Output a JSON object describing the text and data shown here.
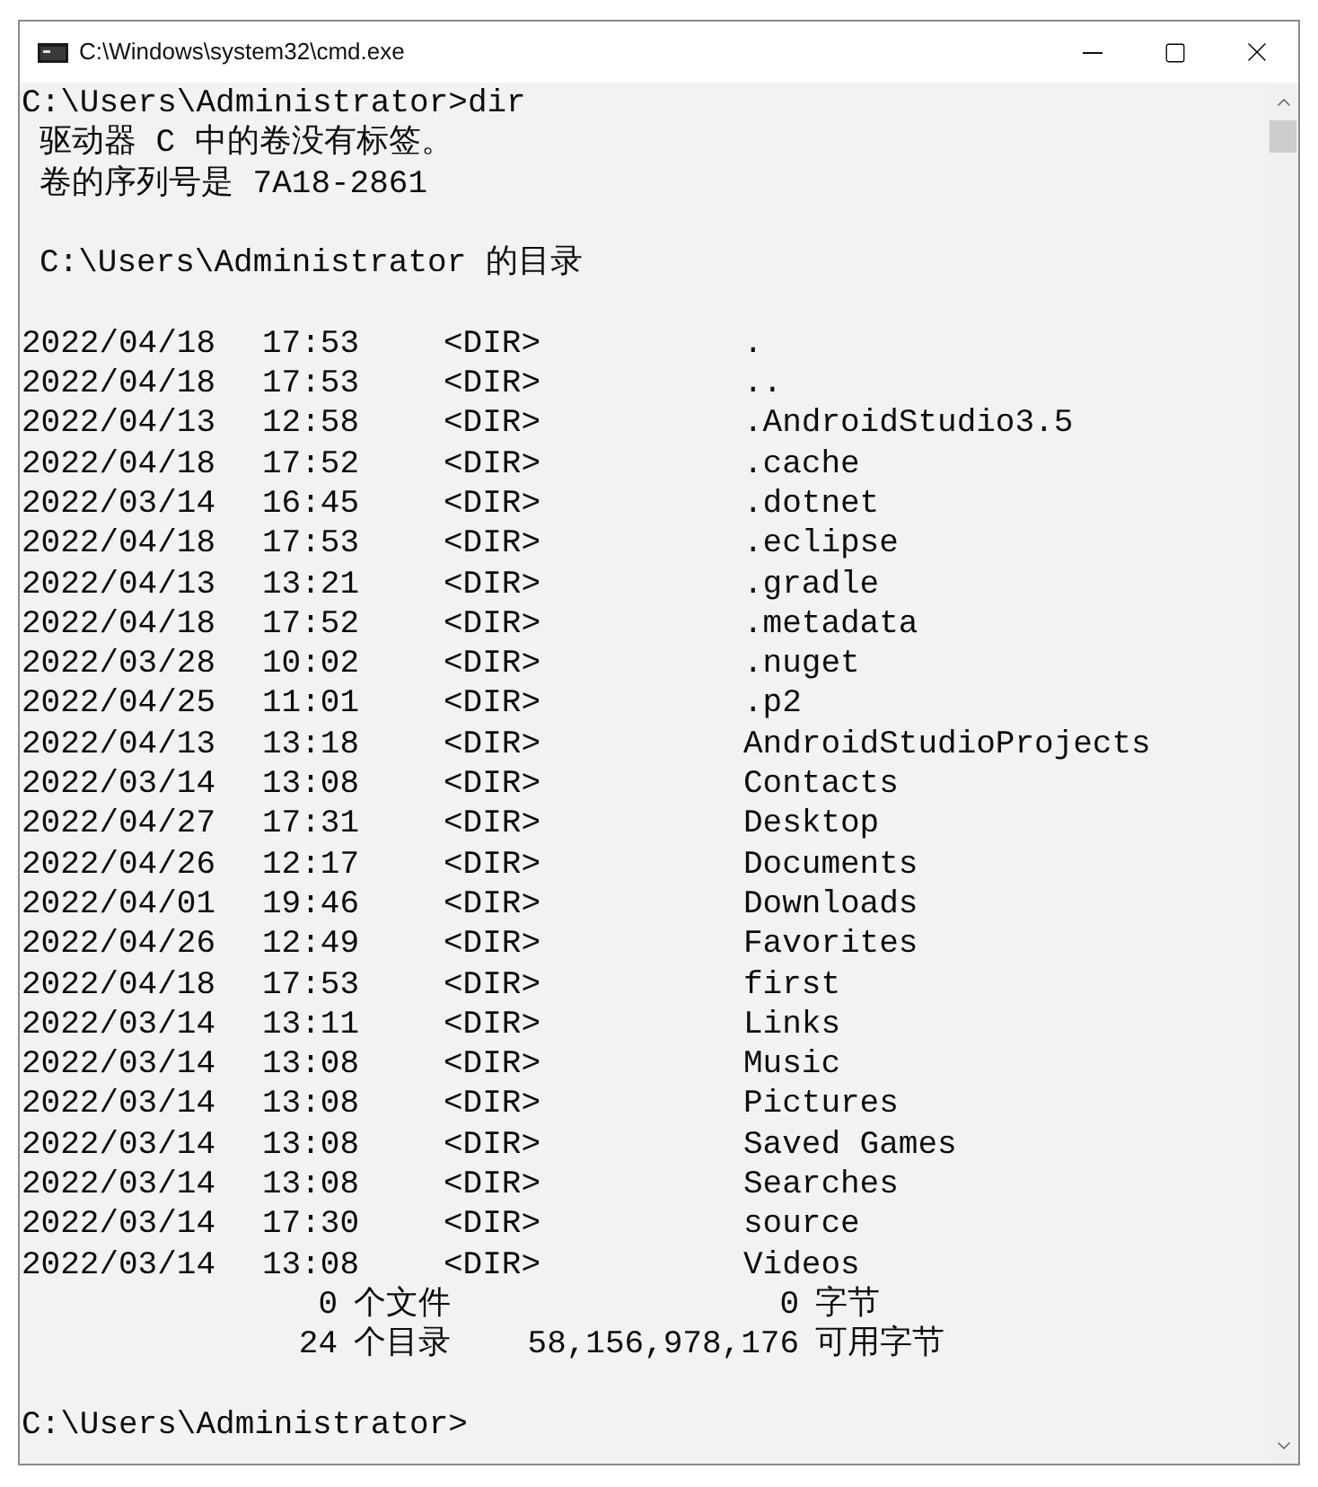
{
  "window": {
    "title": "C:\\Windows\\system32\\cmd.exe"
  },
  "command_line": "C:\\Users\\Administrator>dir",
  "volume_lines": [
    "驱动器 C 中的卷没有标签。",
    "卷的序列号是 7A18-2861"
  ],
  "listing_header": "C:\\Users\\Administrator 的目录",
  "entries": [
    {
      "date": "2022/04/18",
      "time": "17:53",
      "type": "<DIR>",
      "name": "."
    },
    {
      "date": "2022/04/18",
      "time": "17:53",
      "type": "<DIR>",
      "name": ".."
    },
    {
      "date": "2022/04/13",
      "time": "12:58",
      "type": "<DIR>",
      "name": ".AndroidStudio3.5"
    },
    {
      "date": "2022/04/18",
      "time": "17:52",
      "type": "<DIR>",
      "name": ".cache"
    },
    {
      "date": "2022/03/14",
      "time": "16:45",
      "type": "<DIR>",
      "name": ".dotnet"
    },
    {
      "date": "2022/04/18",
      "time": "17:53",
      "type": "<DIR>",
      "name": ".eclipse"
    },
    {
      "date": "2022/04/13",
      "time": "13:21",
      "type": "<DIR>",
      "name": ".gradle"
    },
    {
      "date": "2022/04/18",
      "time": "17:52",
      "type": "<DIR>",
      "name": ".metadata"
    },
    {
      "date": "2022/03/28",
      "time": "10:02",
      "type": "<DIR>",
      "name": ".nuget"
    },
    {
      "date": "2022/04/25",
      "time": "11:01",
      "type": "<DIR>",
      "name": ".p2"
    },
    {
      "date": "2022/04/13",
      "time": "13:18",
      "type": "<DIR>",
      "name": "AndroidStudioProjects"
    },
    {
      "date": "2022/03/14",
      "time": "13:08",
      "type": "<DIR>",
      "name": "Contacts"
    },
    {
      "date": "2022/04/27",
      "time": "17:31",
      "type": "<DIR>",
      "name": "Desktop"
    },
    {
      "date": "2022/04/26",
      "time": "12:17",
      "type": "<DIR>",
      "name": "Documents"
    },
    {
      "date": "2022/04/01",
      "time": "19:46",
      "type": "<DIR>",
      "name": "Downloads"
    },
    {
      "date": "2022/04/26",
      "time": "12:49",
      "type": "<DIR>",
      "name": "Favorites"
    },
    {
      "date": "2022/04/18",
      "time": "17:53",
      "type": "<DIR>",
      "name": "first"
    },
    {
      "date": "2022/03/14",
      "time": "13:11",
      "type": "<DIR>",
      "name": "Links"
    },
    {
      "date": "2022/03/14",
      "time": "13:08",
      "type": "<DIR>",
      "name": "Music"
    },
    {
      "date": "2022/03/14",
      "time": "13:08",
      "type": "<DIR>",
      "name": "Pictures"
    },
    {
      "date": "2022/03/14",
      "time": "13:08",
      "type": "<DIR>",
      "name": "Saved Games"
    },
    {
      "date": "2022/03/14",
      "time": "13:08",
      "type": "<DIR>",
      "name": "Searches"
    },
    {
      "date": "2022/03/14",
      "time": "17:30",
      "type": "<DIR>",
      "name": "source"
    },
    {
      "date": "2022/03/14",
      "time": "13:08",
      "type": "<DIR>",
      "name": "Videos"
    }
  ],
  "summary": [
    {
      "count": "0",
      "label": "个文件",
      "bytes": "0",
      "unit": "字节"
    },
    {
      "count": "24",
      "label": "个目录",
      "bytes": "58,156,978,176",
      "unit": "可用字节"
    }
  ],
  "prompt": "C:\\Users\\Administrator>"
}
